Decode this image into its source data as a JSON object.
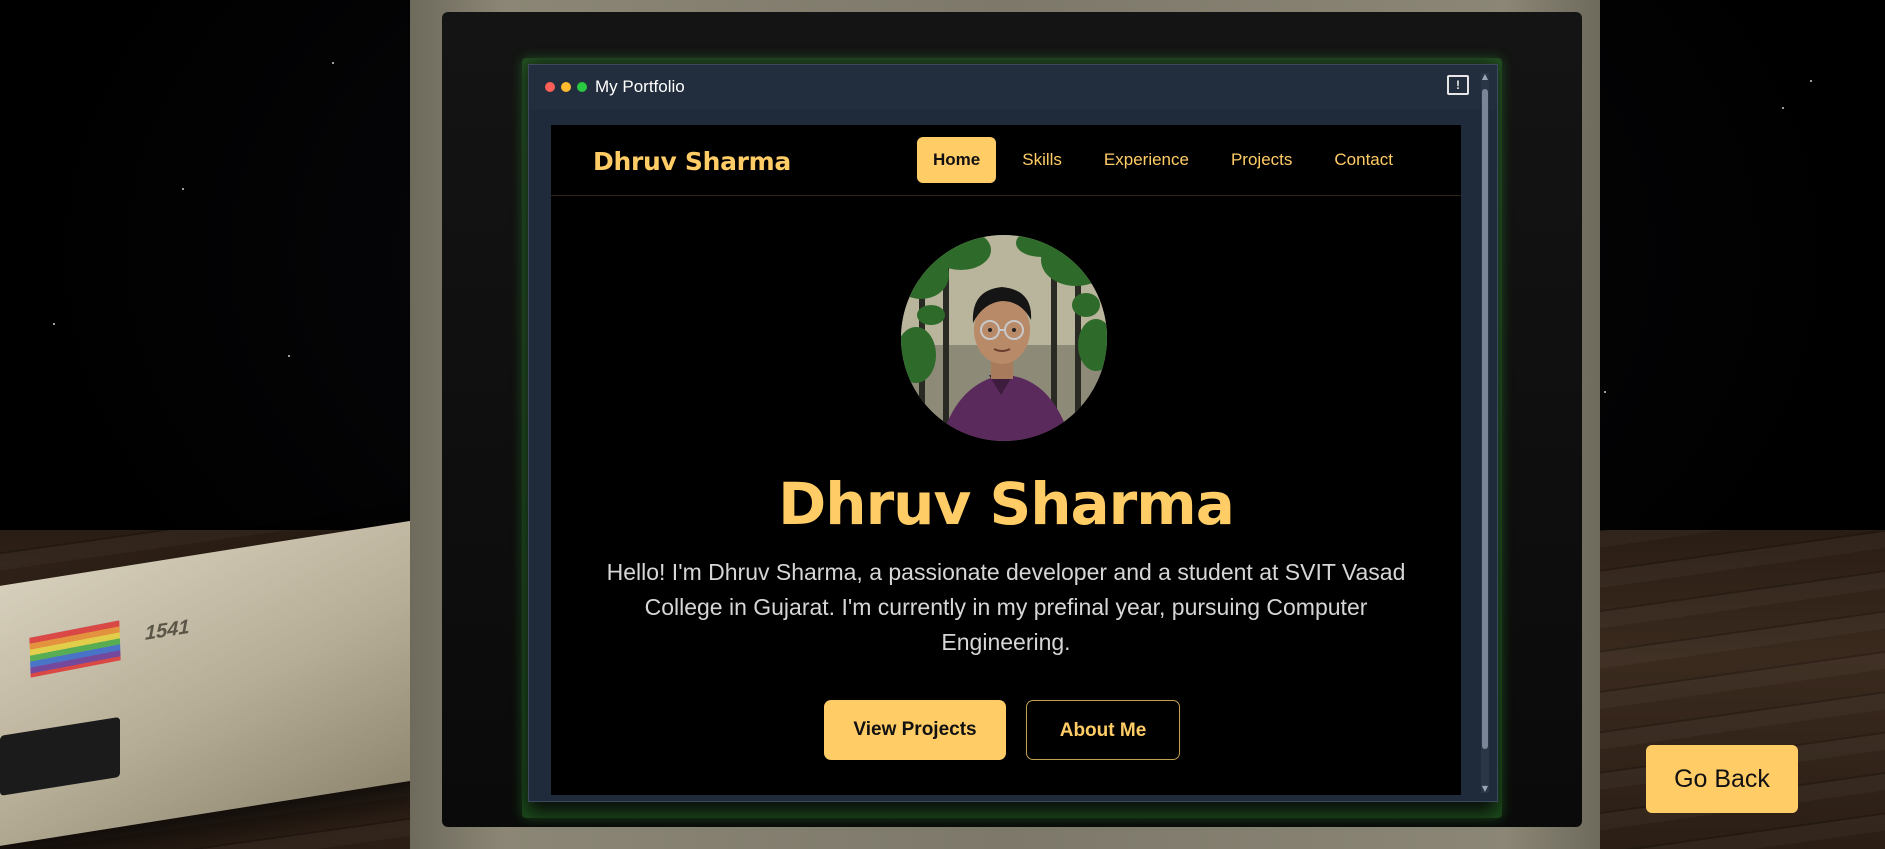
{
  "window": {
    "title": "My Portfolio",
    "traffic_lights": [
      "#ff5f57",
      "#febc2e",
      "#28c840"
    ],
    "feedback_icon": "exclamation-box-icon",
    "feedback_glyph": "!"
  },
  "navbar": {
    "brand": "Dhruv Sharma",
    "links": [
      {
        "label": "Home",
        "active": true
      },
      {
        "label": "Skills",
        "active": false
      },
      {
        "label": "Experience",
        "active": false
      },
      {
        "label": "Projects",
        "active": false
      },
      {
        "label": "Contact",
        "active": false
      }
    ]
  },
  "hero": {
    "avatar": "profile-photo",
    "name": "Dhruv Sharma",
    "bio": "Hello! I'm Dhruv Sharma, a passionate developer and a student at SVIT Vasad College in Gujarat. I'm currently in my prefinal year, pursuing Computer Engineering.",
    "primary_button": "View Projects",
    "secondary_button": "About Me"
  },
  "scene": {
    "drive_model": "1541",
    "go_back_label": "Go Back"
  },
  "colors": {
    "accent": "#ffcc66",
    "page_bg": "#000000",
    "text": "#d6d6d6",
    "monitor_glow": "#3cc83c"
  }
}
